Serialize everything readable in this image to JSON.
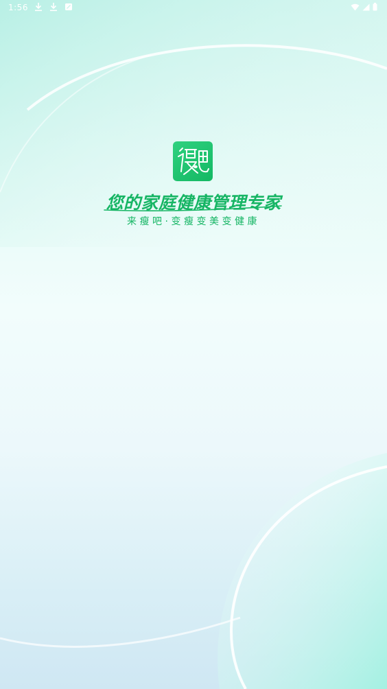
{
  "status_bar": {
    "time": "1:56",
    "left_icons": [
      "download-icon",
      "download-icon",
      "app-notification-icon"
    ],
    "right_icons": [
      "wifi-icon",
      "cellular-signal-icon",
      "battery-icon"
    ]
  },
  "splash": {
    "logo_text": "瘦吧",
    "slogan": "您的家庭健康管理专家",
    "subtitle": "来瘦吧·变瘦变美变健康"
  },
  "colors": {
    "brand_green": "#16b564",
    "logo_bg": "#1fc26e"
  }
}
